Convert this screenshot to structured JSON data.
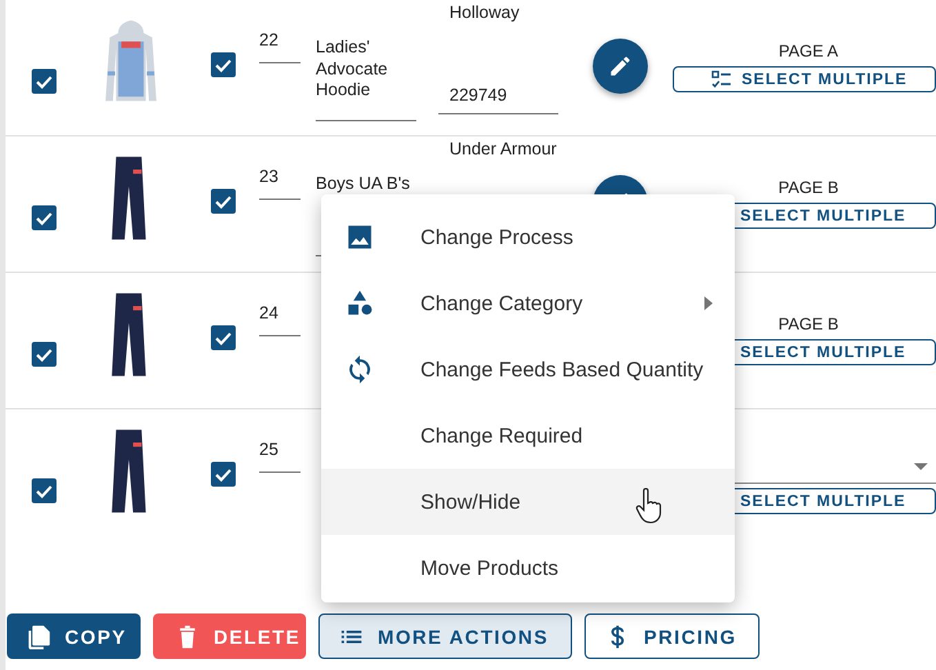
{
  "rows": [
    {
      "checked": true,
      "included": true,
      "number": "22",
      "name": "Ladies' Advocate Hoodie",
      "brand": "Holloway",
      "sku": "229749",
      "page": {
        "kind": "label",
        "text": "PAGE A"
      },
      "select_button": "SELECT MULTIPLE"
    },
    {
      "checked": true,
      "included": true,
      "number": "23",
      "name": "Boys UA B's",
      "brand": "Under Armour",
      "page": {
        "kind": "label",
        "text": "PAGE B"
      },
      "select_button": "SELECT MULTIPLE"
    },
    {
      "checked": true,
      "included": true,
      "number": "24",
      "page": {
        "kind": "label",
        "text": "PAGE B"
      },
      "select_button": "SELECT MULTIPLE"
    },
    {
      "checked": true,
      "included": true,
      "number": "25",
      "page": {
        "kind": "select"
      },
      "select_button": "SELECT MULTIPLE"
    }
  ],
  "menu": {
    "items": [
      {
        "label": "Change Process",
        "submenu": false,
        "selected": false
      },
      {
        "label": "Change Category",
        "submenu": true,
        "selected": false
      },
      {
        "label": "Change Feeds Based Quantity",
        "submenu": false,
        "selected": false
      },
      {
        "label": "Change Required",
        "submenu": false,
        "selected": false
      },
      {
        "label": "Show/Hide",
        "submenu": false,
        "selected": true
      },
      {
        "label": "Move Products",
        "submenu": false,
        "selected": false
      }
    ]
  },
  "actions": [
    {
      "label": "COPY",
      "kind": "copy",
      "active": false
    },
    {
      "label": "DELETE",
      "kind": "delete",
      "active": false
    },
    {
      "label": "MORE ACTIONS",
      "kind": "more",
      "active": true
    },
    {
      "label": "PRICING",
      "kind": "pricing",
      "active": false
    }
  ]
}
